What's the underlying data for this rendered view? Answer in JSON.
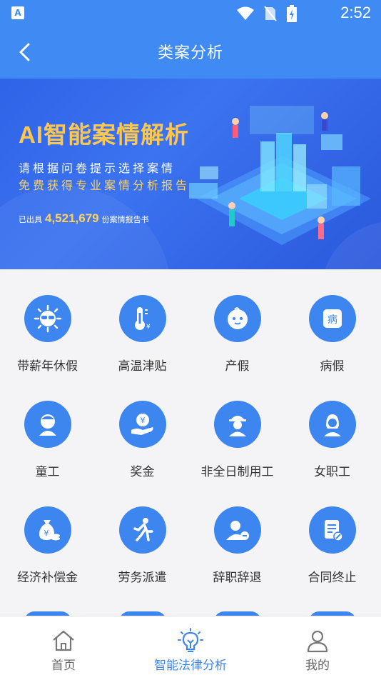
{
  "status_bar": {
    "time": "2:52",
    "app_badge": "A"
  },
  "header": {
    "title": "类案分析"
  },
  "banner": {
    "headline": "AI智能案情解析",
    "line1": "请根据问卷提示选择案情",
    "line2": "免费获得专业案情分析报告",
    "issued_prefix": "已出具",
    "issued_count": "4,521,679",
    "issued_suffix": "份案情报告书"
  },
  "categories": [
    {
      "label": "带薪年休假",
      "icon": "sun-glasses-icon"
    },
    {
      "label": "高温津贴",
      "icon": "thermometer-icon"
    },
    {
      "label": "产假",
      "icon": "baby-face-icon"
    },
    {
      "label": "病假",
      "icon": "sick-note-icon"
    },
    {
      "label": "童工",
      "icon": "child-icon"
    },
    {
      "label": "奖金",
      "icon": "yen-hand-icon"
    },
    {
      "label": "非全日制用工",
      "icon": "worker-icon"
    },
    {
      "label": "女职工",
      "icon": "female-worker-icon"
    },
    {
      "label": "经济补偿金",
      "icon": "money-bag-icon"
    },
    {
      "label": "劳务派遣",
      "icon": "running-man-icon"
    },
    {
      "label": "辞职辞退",
      "icon": "user-minus-icon"
    },
    {
      "label": "合同终止",
      "icon": "contract-icon"
    }
  ],
  "tabbar": {
    "tabs": [
      {
        "label": "首页",
        "icon": "home-icon"
      },
      {
        "label": "智能法律分析",
        "icon": "bulb-icon"
      },
      {
        "label": "我的",
        "icon": "user-icon"
      }
    ],
    "active_index": 1
  },
  "colors": {
    "primary": "#3f8bf3",
    "accent": "#3e86ef",
    "banner_gold": "#ffc74d"
  }
}
